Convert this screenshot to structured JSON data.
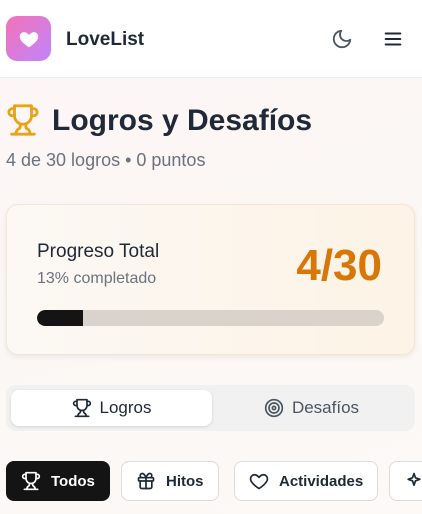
{
  "app": {
    "name": "LoveList"
  },
  "icons": {
    "logo": "heart-icon",
    "theme": "moon-icon",
    "menu": "menu-icon",
    "title": "trophy-icon"
  },
  "colors": {
    "brand_gradient_start": "#f472b6",
    "brand_gradient_end": "#c084fc",
    "accent": "#d97706",
    "progress_fill": "#141414"
  },
  "page": {
    "title": "Logros y Desafíos",
    "subtitle": "4 de 30 logros • 0 puntos"
  },
  "progress": {
    "title": "Progreso Total",
    "subtitle": "13% completado",
    "count": "4/30",
    "fraction": 0.133
  },
  "tabs": [
    {
      "label": "Logros",
      "icon": "trophy-icon",
      "active": true
    },
    {
      "label": "Desafíos",
      "icon": "target-icon",
      "active": false
    }
  ],
  "filters": [
    {
      "label": "Todos",
      "icon": "trophy-icon",
      "active": true
    },
    {
      "label": "Hitos",
      "icon": "gift-icon",
      "active": false
    },
    {
      "label": "Actividades",
      "icon": "heart-icon",
      "active": false
    },
    {
      "label": "",
      "icon": "sparkles-icon",
      "active": false
    }
  ]
}
